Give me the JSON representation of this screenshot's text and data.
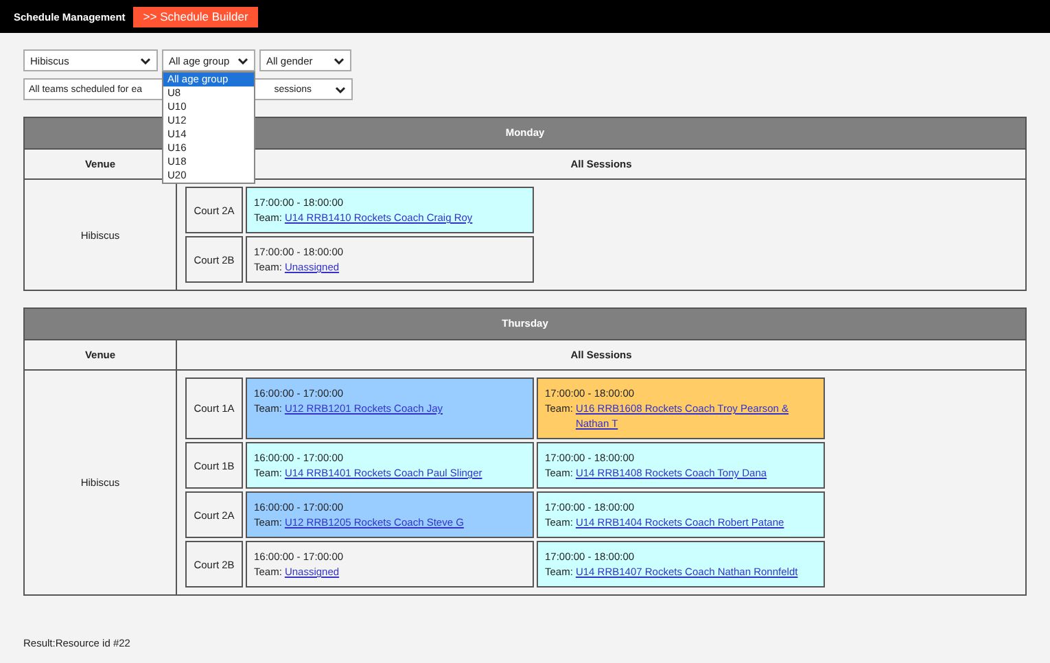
{
  "top_bar": {
    "title": "Schedule Management",
    "builder_button": ">> Schedule Builder"
  },
  "filters": {
    "venue": "Hibiscus",
    "age_group": "All age group",
    "gender": "All gender",
    "schedule_start": "All teams scheduled for ea",
    "schedule_end": "sessions"
  },
  "age_dropdown": [
    {
      "label": "All age group",
      "selected": true
    },
    {
      "label": "U8",
      "selected": false
    },
    {
      "label": "U10",
      "selected": false
    },
    {
      "label": "U12",
      "selected": false
    },
    {
      "label": "U14",
      "selected": false
    },
    {
      "label": "U16",
      "selected": false
    },
    {
      "label": "U18",
      "selected": false
    },
    {
      "label": "U20",
      "selected": false
    }
  ],
  "days": [
    {
      "title": "Monday",
      "venue_header": "Venue",
      "sessions_header": "All Sessions",
      "venue": "Hibiscus",
      "courts": [
        {
          "name": "Court 2A",
          "sessions": [
            {
              "time": "17:00:00 - 18:00:00",
              "team_label": "Team:",
              "team": "U14 RRB1410 Rockets Coach Craig Roy",
              "color": "#ccffff"
            }
          ]
        },
        {
          "name": "Court 2B",
          "sessions": [
            {
              "time": "17:00:00 - 18:00:00",
              "team_label": "Team:",
              "team": "Unassigned",
              "color": "#f3f3f3"
            }
          ]
        }
      ]
    },
    {
      "title": "Thursday",
      "venue_header": "Venue",
      "sessions_header": "All Sessions",
      "venue": "Hibiscus",
      "courts": [
        {
          "name": "Court 1A",
          "sessions": [
            {
              "time": "16:00:00 - 17:00:00",
              "team_label": "Team:",
              "team": "U12 RRB1201 Rockets Coach Jay",
              "color": "#99ccff"
            },
            {
              "time": "17:00:00 - 18:00:00",
              "team_label": "Team:",
              "team": "U16 RRB1608 Rockets Coach Troy Pearson & Nathan T",
              "color": "#ffcc66"
            }
          ]
        },
        {
          "name": "Court 1B",
          "sessions": [
            {
              "time": "16:00:00 - 17:00:00",
              "team_label": "Team:",
              "team": "U14 RRB1401 Rockets Coach Paul Slinger",
              "color": "#ccffff"
            },
            {
              "time": "17:00:00 - 18:00:00",
              "team_label": "Team:",
              "team": "U14 RRB1408 Rockets Coach Tony Dana",
              "color": "#ccffff"
            }
          ]
        },
        {
          "name": "Court 2A",
          "sessions": [
            {
              "time": "16:00:00 - 17:00:00",
              "team_label": "Team:",
              "team": "U12 RRB1205 Rockets Coach Steve G",
              "color": "#99ccff"
            },
            {
              "time": "17:00:00 - 18:00:00",
              "team_label": "Team:",
              "team": "U14 RRB1404 Rockets Coach Robert Patane",
              "color": "#ccffff"
            }
          ]
        },
        {
          "name": "Court 2B",
          "sessions": [
            {
              "time": "16:00:00 - 17:00:00",
              "team_label": "Team:",
              "team": "Unassigned",
              "color": "#f3f3f3"
            },
            {
              "time": "17:00:00 - 18:00:00",
              "team_label": "Team:",
              "team": "U14 RRB1407 Rockets Coach Nathan Ronnfeldt",
              "color": "#ccffff"
            }
          ]
        }
      ]
    }
  ],
  "footer": "Result:Resource id #22"
}
